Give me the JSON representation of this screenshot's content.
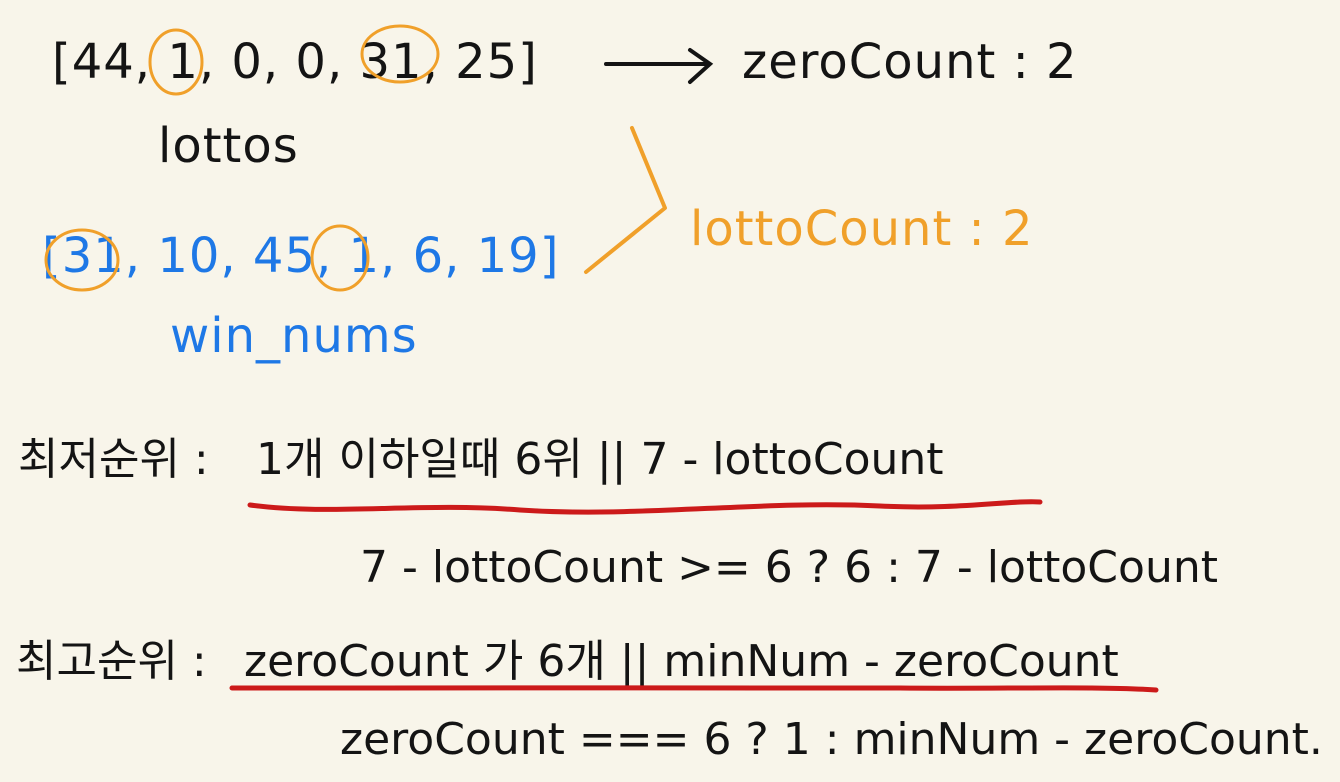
{
  "lottos": {
    "array_text": "[44, 1, 0, 0, 31, 25]",
    "label": "lottos"
  },
  "win_nums": {
    "array_text": "[31, 10, 45, 1, 6, 19]",
    "label": "win_nums"
  },
  "counts": {
    "zero_count": "zeroCount : 2",
    "lotto_count": "lottoCount : 2"
  },
  "lowest_rank": {
    "label": "최저순위 :",
    "rule": "1개 이하일때  6위  ||  7 - lottoCount",
    "code": "7 - lottoCount >= 6 ? 6 : 7 - lottoCount"
  },
  "highest_rank": {
    "label": "최고순위 :",
    "rule": "zeroCount 가  6개  ||  minNum - zeroCount",
    "code": "zeroCount === 6 ?  1 : minNum - zeroCount."
  },
  "colors": {
    "ink": "#141414",
    "blue": "#1e78e6",
    "orange": "#f0a02a",
    "red_underline": "#cc1a1a",
    "paper": "#f8f5ea"
  }
}
